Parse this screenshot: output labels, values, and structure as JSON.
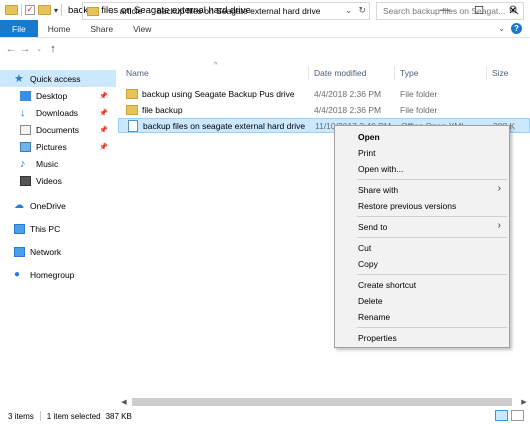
{
  "window": {
    "title": "backup files on Seagate external hard drive",
    "minimize": "—",
    "maximize": "☐",
    "close": "✕"
  },
  "ribbon": {
    "tabs": [
      "File",
      "Home",
      "Share",
      "View"
    ]
  },
  "address": {
    "path": [
      "article",
      "backup files on Seagate external hard drive"
    ],
    "search_placeholder": "Search backup files on Seagat..."
  },
  "nav_pane": {
    "items": [
      {
        "label": "Quick access",
        "icon": "star-icon",
        "selected": true
      },
      {
        "label": "Desktop",
        "icon": "desktop-icon",
        "pinned": true
      },
      {
        "label": "Downloads",
        "icon": "download-icon",
        "pinned": true
      },
      {
        "label": "Documents",
        "icon": "documents-icon",
        "pinned": true
      },
      {
        "label": "Pictures",
        "icon": "pictures-icon",
        "pinned": true
      },
      {
        "label": "Music",
        "icon": "music-icon"
      },
      {
        "label": "Videos",
        "icon": "videos-icon"
      },
      {
        "label": "OneDrive",
        "icon": "cloud-icon"
      },
      {
        "label": "This PC",
        "icon": "computer-icon"
      },
      {
        "label": "Network",
        "icon": "network-icon"
      },
      {
        "label": "Homegroup",
        "icon": "homegroup-icon"
      }
    ]
  },
  "file_list": {
    "columns": [
      "Name",
      "Date modified",
      "Type",
      "Size"
    ],
    "rows": [
      {
        "name": "backup using Seagate Backup Pus drive",
        "date": "4/4/2018 2:36 PM",
        "type": "File folder",
        "size": "",
        "icon": "folder-icon"
      },
      {
        "name": "file backup",
        "date": "4/4/2018 2:36 PM",
        "type": "File folder",
        "size": "",
        "icon": "folder-icon"
      },
      {
        "name": "backup files on seagate external hard drive",
        "date": "11/10/2017 2:40 PM",
        "type": "Office Open XML...",
        "size": "388 K",
        "icon": "document-icon",
        "selected": true
      }
    ]
  },
  "context_menu": {
    "items": [
      {
        "label": "Open",
        "bold": true
      },
      {
        "label": "Print"
      },
      {
        "label": "Open with..."
      },
      {
        "label": "Share with",
        "submenu": true
      },
      {
        "label": "Restore previous versions"
      },
      {
        "label": "Send to",
        "submenu": true
      },
      {
        "label": "Cut"
      },
      {
        "label": "Copy"
      },
      {
        "label": "Create shortcut"
      },
      {
        "label": "Delete"
      },
      {
        "label": "Rename"
      },
      {
        "label": "Properties"
      }
    ]
  },
  "status": {
    "items_count": "3 items",
    "selection": "1 item selected",
    "size": "387 KB"
  },
  "colors": {
    "accent": "#1979ca",
    "selection": "#cce8ff",
    "folder": "#e8c25d"
  }
}
